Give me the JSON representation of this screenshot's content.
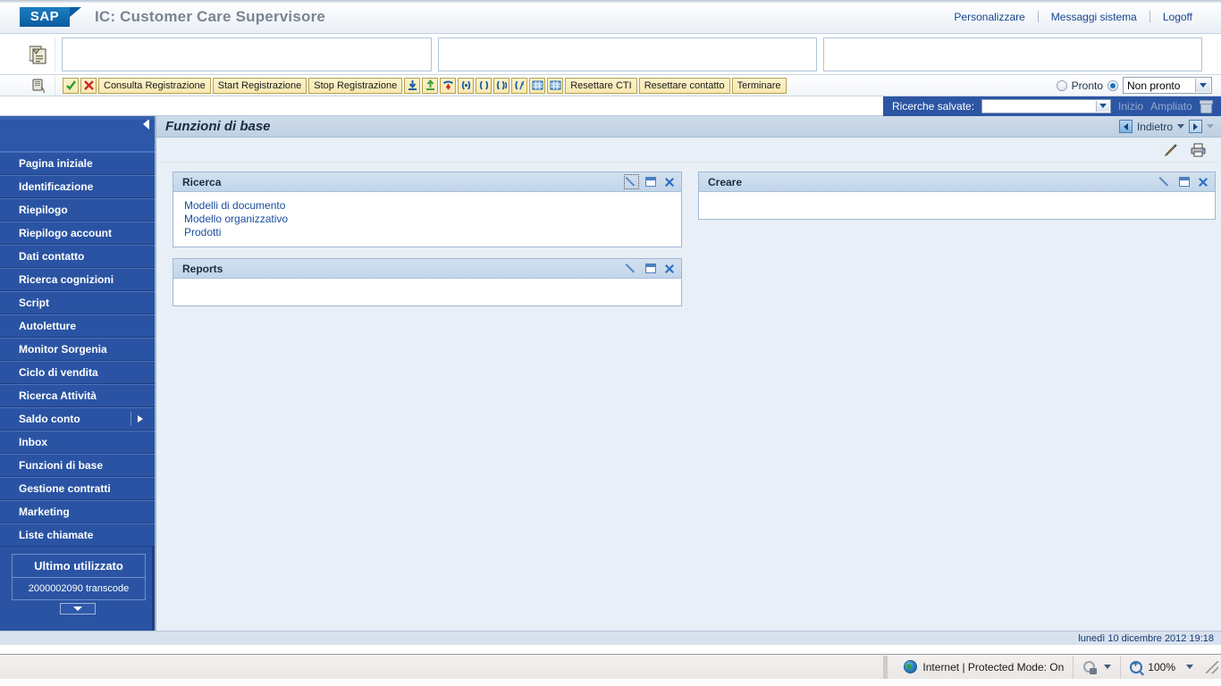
{
  "header": {
    "logo_text": "SAP",
    "logo_icon": "sap-logo-icon",
    "title": "IC: Customer Care Supervisore",
    "links": [
      {
        "label": "Personalizzare"
      },
      {
        "label": "Messaggi sistema"
      },
      {
        "label": "Logoff"
      }
    ]
  },
  "contact_bar": {
    "icon": "clipboard-icon",
    "field1_value": "",
    "field2_value": "",
    "field3_value": ""
  },
  "cti_toolbar": {
    "phone_icon": "telephone-icon",
    "buttons": [
      {
        "label": "",
        "icon": "green-check-icon",
        "type": "icon"
      },
      {
        "label": "",
        "icon": "red-x-icon",
        "type": "icon"
      },
      {
        "label": "Consulta Registrazione",
        "type": "text"
      },
      {
        "label": "Start Registrazione",
        "type": "text"
      },
      {
        "label": "Stop Registrazione",
        "type": "text"
      },
      {
        "label": "",
        "icon": "call-accept-down-icon",
        "type": "icon"
      },
      {
        "label": "",
        "icon": "call-release-up-icon",
        "type": "icon"
      },
      {
        "label": "",
        "icon": "hangup-phone-icon",
        "type": "icon"
      },
      {
        "label": "",
        "icon": "conference-call-icon",
        "type": "icon"
      },
      {
        "label": "",
        "icon": "hold-call-icon",
        "type": "icon"
      },
      {
        "label": "",
        "icon": "transfer-call-icon",
        "type": "icon"
      },
      {
        "label": "",
        "icon": "consult-call-icon",
        "type": "icon"
      },
      {
        "label": "",
        "icon": "dialpad-icon",
        "type": "icon"
      },
      {
        "label": "",
        "icon": "dialpad-alt-icon",
        "type": "icon"
      },
      {
        "label": "Resettare CTI",
        "type": "text"
      },
      {
        "label": "Resettare contatto",
        "type": "text"
      },
      {
        "label": "Terminare",
        "type": "text"
      }
    ],
    "status": {
      "ready_label": "Pronto",
      "ready_selected": false,
      "notready_selected": true,
      "notready_value": "Non pronto"
    }
  },
  "saved_search": {
    "label": "Ricerche salvate:",
    "value": "",
    "start_link": "Inizio",
    "extended_link": "Ampliato",
    "delete_icon": "trash-icon"
  },
  "sidebar": {
    "collapse_icon": "collapse-left-icon",
    "items": [
      {
        "label": "Pagina iniziale",
        "has_submenu": false
      },
      {
        "label": "Identificazione",
        "has_submenu": false
      },
      {
        "label": "Riepilogo",
        "has_submenu": false
      },
      {
        "label": "Riepilogo account",
        "has_submenu": false
      },
      {
        "label": "Dati contatto",
        "has_submenu": false
      },
      {
        "label": "Ricerca cognizioni",
        "has_submenu": false
      },
      {
        "label": "Script",
        "has_submenu": false
      },
      {
        "label": "Autoletture",
        "has_submenu": false
      },
      {
        "label": "Monitor Sorgenia",
        "has_submenu": false
      },
      {
        "label": "Ciclo di vendita",
        "has_submenu": false
      },
      {
        "label": "Ricerca Attività",
        "has_submenu": false
      },
      {
        "label": "Saldo conto",
        "has_submenu": true
      },
      {
        "label": "Inbox",
        "has_submenu": false
      },
      {
        "label": "Funzioni di base",
        "has_submenu": false
      },
      {
        "label": "Gestione contratti",
        "has_submenu": false
      },
      {
        "label": "Marketing",
        "has_submenu": false
      },
      {
        "label": "Liste chiamate",
        "has_submenu": false
      }
    ],
    "recent": {
      "title": "Ultimo utilizzato",
      "entries": [
        {
          "label": "2000002090 transcode"
        }
      ],
      "more_icon": "chevron-down-icon"
    }
  },
  "work_area": {
    "title": "Funzioni di base",
    "back_label": "Indietro",
    "back_icon": "back-arrow-icon",
    "forward_icon": "forward-arrow-icon",
    "edit_icon": "pencil-icon",
    "print_icon": "printer-icon"
  },
  "panels": [
    {
      "id": "ricerca",
      "title": "Ricerca",
      "column": "left",
      "personalize_icon": "pencil-icon",
      "minimize_icon": "minimize-icon",
      "close_icon": "close-icon",
      "links": [
        {
          "label": "Modelli di documento"
        },
        {
          "label": "Modello organizzativo"
        },
        {
          "label": "Prodotti"
        }
      ]
    },
    {
      "id": "reports",
      "title": "Reports",
      "column": "left",
      "personalize_icon": "pencil-icon",
      "minimize_icon": "minimize-icon",
      "close_icon": "close-icon",
      "links": []
    },
    {
      "id": "creare",
      "title": "Creare",
      "column": "right",
      "personalize_icon": "pencil-icon",
      "minimize_icon": "minimize-icon",
      "close_icon": "close-icon",
      "links": []
    }
  ],
  "status_bar": {
    "datetime": "lunedì 10 dicembre 2012 19:18",
    "zone_icon": "globe-icon",
    "zone_text": "Internet | Protected Mode: On",
    "protected_icon": "protected-mode-icon",
    "zoom_icon": "zoom-icon",
    "zoom_level": "100%"
  }
}
